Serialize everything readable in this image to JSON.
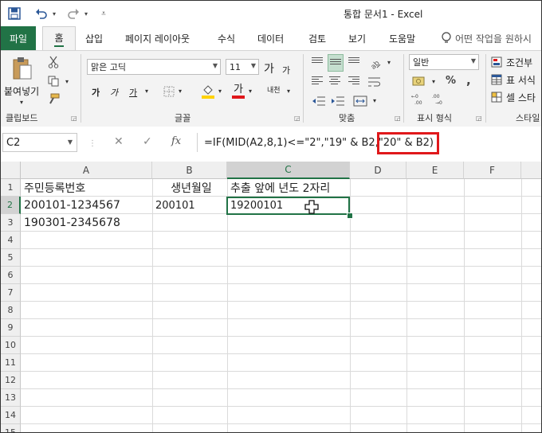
{
  "window": {
    "title": "통합 문서1  -  Excel"
  },
  "qat": {
    "save": "save-icon",
    "undo": "undo-icon",
    "redo": "redo-icon",
    "customize": "customize-icon"
  },
  "tabs": [
    {
      "label": "파일"
    },
    {
      "label": "홈"
    },
    {
      "label": "삽입"
    },
    {
      "label": "페이지 레이아웃"
    },
    {
      "label": "수식"
    },
    {
      "label": "데이터"
    },
    {
      "label": "검토"
    },
    {
      "label": "보기"
    },
    {
      "label": "도움말"
    }
  ],
  "tell_me": {
    "placeholder": "어떤 작업을 원하시"
  },
  "ribbon": {
    "clipboard": {
      "paste_label": "붙여넣기",
      "group_label": "클립보드"
    },
    "font": {
      "font_name": "맑은 고딕",
      "font_size": "11",
      "grow": "가",
      "shrink": "가",
      "bold": "가",
      "italic": "가",
      "underline": "가",
      "group_label": "글꼴",
      "phonetic": "내천"
    },
    "alignment": {
      "group_label": "맞춤"
    },
    "number": {
      "format": "일반",
      "percent": "%",
      "comma": ",",
      "group_label": "표시 형식"
    },
    "styles": {
      "conditional": "조건부",
      "table": "표 서식",
      "cell": "셀 스타",
      "group_label": "스타일"
    }
  },
  "formula_bar": {
    "name_box": "C2",
    "cancel": "✕",
    "enter": "✓",
    "fx": "fx",
    "formula": "=IF(MID(A2,8,1)<=\"2\",\"19\" & B2,\"20\" & B2)"
  },
  "grid": {
    "columns": [
      "A",
      "B",
      "C",
      "D",
      "E",
      "F"
    ],
    "rows": [
      "1",
      "2",
      "3",
      "4",
      "5",
      "6",
      "7",
      "8",
      "9",
      "10",
      "11",
      "12",
      "13",
      "14",
      "15"
    ],
    "cells": {
      "A1": "주민등록번호",
      "B1": "생년월일",
      "C1": "추출 앞에 년도 2자리",
      "A2": "200101-1234567",
      "B2": "200101",
      "C2": "19200101",
      "A3": "190301-2345678"
    },
    "selected_cell": "C2",
    "highlight_color": "#e0181b",
    "accent_color": "#217346"
  }
}
